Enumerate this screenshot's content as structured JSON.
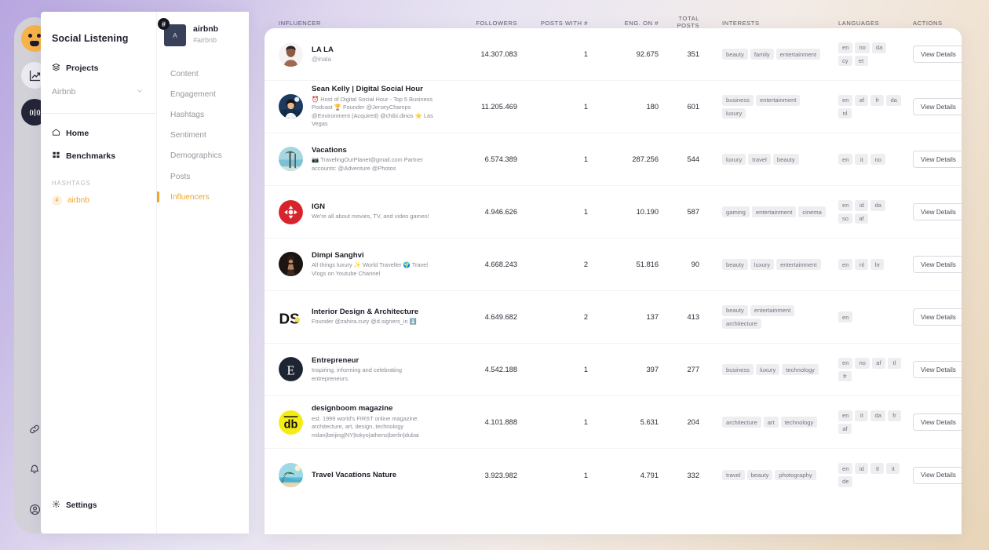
{
  "rail": {
    "items": [
      {
        "name": "brand-logo-icon"
      },
      {
        "name": "analytics-icon"
      },
      {
        "name": "broadcast-icon"
      },
      {
        "name": "link-icon"
      },
      {
        "name": "bell-icon"
      },
      {
        "name": "account-icon"
      }
    ]
  },
  "sidebar": {
    "title": "Social Listening",
    "projects_label": "Projects",
    "project_selected": "Airbnb",
    "nav": [
      {
        "label": "Home",
        "icon": "home-icon"
      },
      {
        "label": "Benchmarks",
        "icon": "grid-icon"
      }
    ],
    "hashtags_header": "HASHTAGS",
    "hashtag": "airbnb",
    "hashtag_symbol": "#",
    "settings_label": "Settings"
  },
  "project_panel": {
    "avatar_letter": "A",
    "badge": "#",
    "name": "airbnb",
    "tag": "#airbnb",
    "nav": [
      {
        "label": "Content",
        "active": false
      },
      {
        "label": "Engagement",
        "active": false
      },
      {
        "label": "Hashtags",
        "active": false
      },
      {
        "label": "Sentiment",
        "active": false
      },
      {
        "label": "Demographics",
        "active": false
      },
      {
        "label": "Posts",
        "active": false
      },
      {
        "label": "Influencers",
        "active": true
      }
    ]
  },
  "table": {
    "headers": {
      "influencer": "INFLUENCER",
      "followers": "FOLLOWERS",
      "posts_with": "POSTS WITH #",
      "eng_on": "ENG. ON #",
      "total_posts_l1": "TOTAL",
      "total_posts_l2": "POSTS",
      "interests": "INTERESTS",
      "languages": "LANGUAGES",
      "actions": "ACTIONS"
    },
    "action_label": "View Details",
    "rows": [
      {
        "name": "LA LA",
        "handle": "@inala",
        "bio": "",
        "avatar": "photo-portrait",
        "followers": "14.307.083",
        "posts_with": "1",
        "eng_on": "92.675",
        "total_posts": "351",
        "interests": [
          "beauty",
          "family",
          "entertainment"
        ],
        "languages": [
          "en",
          "no",
          "da",
          "cy",
          "et"
        ]
      },
      {
        "name": "Sean Kelly | Digital Social Hour",
        "handle": "",
        "bio": "⏰ Host of Digital Social Hour - Top 5 Business Podcast 🏆 Founder @JerseyChamps @Environment (Acquired) @chibi.dinos ⭐ Las Vegas",
        "avatar": "photo-cartoon",
        "followers": "11.205.469",
        "posts_with": "1",
        "eng_on": "180",
        "total_posts": "601",
        "interests": [
          "business",
          "entertainment",
          "luxury"
        ],
        "languages": [
          "en",
          "af",
          "fr",
          "da",
          "nl"
        ]
      },
      {
        "name": "Vacations",
        "handle": "",
        "bio": "📷 TravelingOurPlanet@gmail.com Partner accounts: @Adventure @Photos",
        "avatar": "photo-beach",
        "followers": "6.574.389",
        "posts_with": "1",
        "eng_on": "287.256",
        "total_posts": "544",
        "interests": [
          "luxury",
          "travel",
          "beauty"
        ],
        "languages": [
          "en",
          "it",
          "no"
        ]
      },
      {
        "name": "IGN",
        "handle": "",
        "bio": "We're all about movies, TV, and video games!",
        "avatar": "ign-logo",
        "followers": "4.946.626",
        "posts_with": "1",
        "eng_on": "10.190",
        "total_posts": "587",
        "interests": [
          "gaming",
          "entertainment",
          "cinema"
        ],
        "languages": [
          "en",
          "id",
          "da",
          "so",
          "af"
        ]
      },
      {
        "name": "Dimpi Sanghvi",
        "handle": "",
        "bio": "All things luxury ✨ World Traveller 🌍 Travel Vlogs on Youtube Channel",
        "avatar": "photo-person",
        "followers": "4.668.243",
        "posts_with": "2",
        "eng_on": "51.816",
        "total_posts": "90",
        "interests": [
          "beauty",
          "luxury",
          "entertainment"
        ],
        "languages": [
          "en",
          "nl",
          "hr"
        ]
      },
      {
        "name": "Interior Design & Architecture",
        "handle": "",
        "bio": "Founder @zahira.cury @d.signers_in ⬇️",
        "avatar": "ds-logo",
        "followers": "4.649.682",
        "posts_with": "2",
        "eng_on": "137",
        "total_posts": "413",
        "interests": [
          "beauty",
          "entertainment",
          "architecture"
        ],
        "languages": [
          "en"
        ]
      },
      {
        "name": "Entrepreneur",
        "handle": "",
        "bio": "Inspiring, informing and celebrating entrepreneurs.",
        "avatar": "entrepreneur-logo",
        "followers": "4.542.188",
        "posts_with": "1",
        "eng_on": "397",
        "total_posts": "277",
        "interests": [
          "business",
          "luxury",
          "technology"
        ],
        "languages": [
          "en",
          "no",
          "af",
          "tl",
          "fr"
        ]
      },
      {
        "name": "designboom magazine",
        "handle": "",
        "bio": "est. 1999 world's FIRST online magazine. architecture, art, design, technology milan|beijing|NY|tokyo|athens|berlin|dubai",
        "avatar": "designboom-logo",
        "followers": "4.101.888",
        "posts_with": "1",
        "eng_on": "5.631",
        "total_posts": "204",
        "interests": [
          "architecture",
          "art",
          "technology"
        ],
        "languages": [
          "en",
          "it",
          "da",
          "fr",
          "af"
        ]
      },
      {
        "name": "Travel Vacations Nature",
        "handle": "",
        "bio": "",
        "avatar": "photo-tropical",
        "followers": "3.923.982",
        "posts_with": "1",
        "eng_on": "4.791",
        "total_posts": "332",
        "interests": [
          "travel",
          "beauty",
          "photography"
        ],
        "languages": [
          "en",
          "id",
          "tl",
          "it",
          "de"
        ]
      }
    ]
  },
  "colors": {
    "accent": "#f0a52e",
    "dark": "#20202e",
    "chip_bg": "#eeeef1"
  }
}
